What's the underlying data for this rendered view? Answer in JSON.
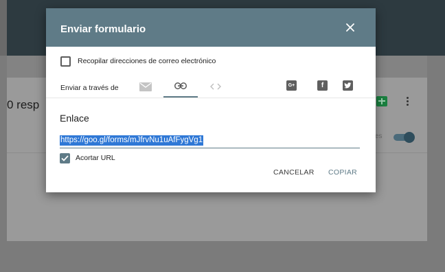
{
  "background": {
    "responses_text": "0 resp",
    "toggle_text": "es"
  },
  "dialog": {
    "title": "Enviar formulario",
    "collect_emails_label": "Recopilar direcciones de correo electrónico",
    "collect_emails_checked": false,
    "send_via_label": "Enviar a través de",
    "tabs": [
      {
        "icon": "email-icon",
        "active": false
      },
      {
        "icon": "link-icon",
        "active": true
      },
      {
        "icon": "embed-icon",
        "active": false
      }
    ],
    "share": {
      "google_plus": "G+",
      "facebook": "f"
    },
    "link_label": "Enlace",
    "url": "https://goo.gl/forms/mJfrvNu1uAfFygVg1",
    "shorten_url_label": "Acortar URL",
    "shorten_url_checked": true,
    "cancel_label": "CANCELAR",
    "copy_label": "COPIAR"
  },
  "colors": {
    "dialog_header": "#5f7b87",
    "accent": "#5f7b87",
    "selection": "#2f78d6"
  }
}
